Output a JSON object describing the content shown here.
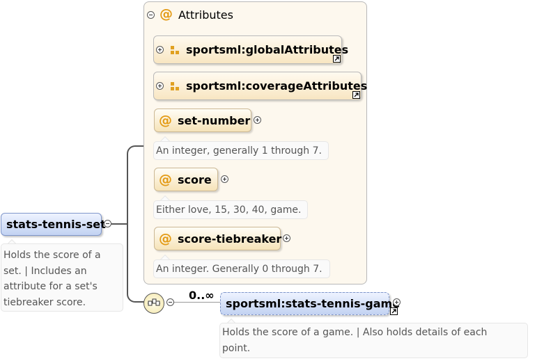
{
  "root": {
    "name": "stats-tennis-set",
    "doc": [
      "Holds the score of a",
      "set. | Includes an",
      "attribute for a set's",
      "tiebreaker score."
    ]
  },
  "attributes_group": {
    "title": "Attributes",
    "refs": [
      {
        "name": "sportsml:globalAttributes"
      },
      {
        "name": "sportsml:coverageAttributes"
      }
    ],
    "attrs": [
      {
        "name": "set-number",
        "doc": "An integer, generally 1 through 7."
      },
      {
        "name": "score",
        "doc": "Either love, 15, 30, 40, game."
      },
      {
        "name": "score-tiebreaker",
        "doc": "An integer. Generally 0 through 7."
      }
    ]
  },
  "sequence": {
    "cardinality": "0..∞"
  },
  "child": {
    "name": "sportsml:stats-tennis-game",
    "doc": [
      "Holds the score of a game. | Also holds details of each",
      "point."
    ]
  },
  "colors": {
    "element_fill": "#c2d2f2",
    "attribute_fill": "#f6e3b8",
    "at_symbol": "#e39a14",
    "connector": "#555555"
  }
}
